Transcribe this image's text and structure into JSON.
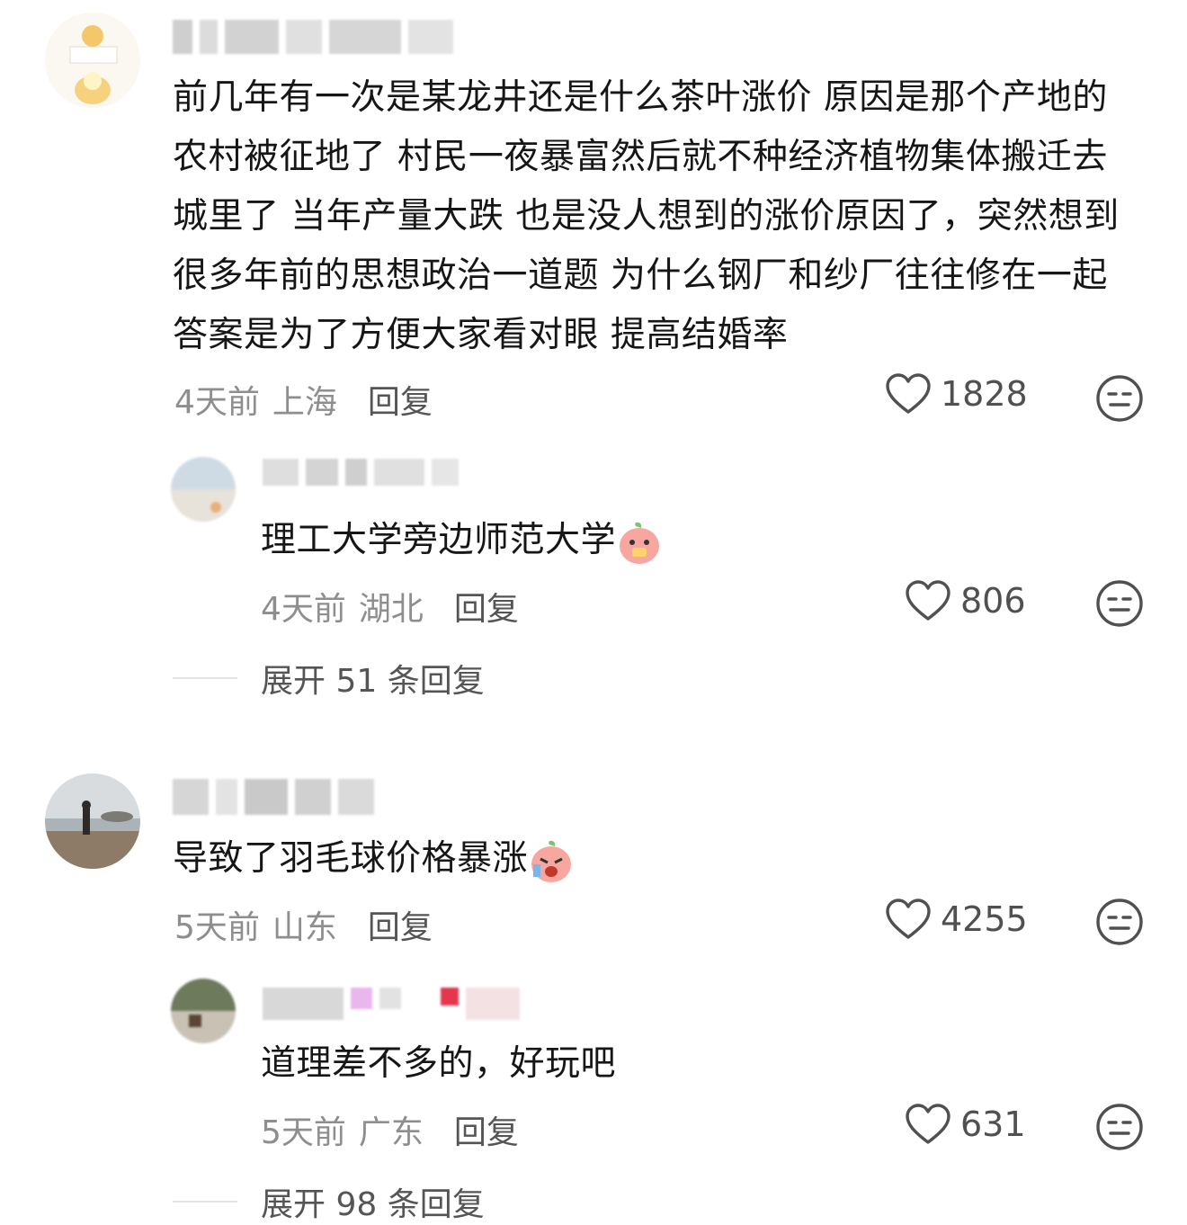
{
  "comments": [
    {
      "text": "前几年有一次是某龙井还是什么茶叶涨价 原因是那个产地的农村被征地了 村民一夜暴富然后就不种经济植物集体搬迁去城里了 当年产量大跌 也是没人想到的涨价原因了，突然想到很多年前的思想政治一道题 为什么钢厂和纱厂往往修在一起 答案是为了方便大家看对眼 提高结婚率",
      "time": "4天前",
      "location": "上海",
      "reply_label": "回复",
      "likes": "1828",
      "reply": {
        "text": "理工大学旁边师范大学",
        "time": "4天前",
        "location": "湖北",
        "reply_label": "回复",
        "likes": "806"
      },
      "expand_label": "展开 51 条回复"
    },
    {
      "text": "导致了羽毛球价格暴涨",
      "time": "5天前",
      "location": "山东",
      "reply_label": "回复",
      "likes": "4255",
      "reply": {
        "text": "道理差不多的，好玩吧",
        "time": "5天前",
        "location": "广东",
        "reply_label": "回复",
        "likes": "631"
      },
      "expand_label": "展开 98 条回复"
    }
  ],
  "icons": {
    "like": "heart-outline-icon",
    "dislike": "neutral-face-icon"
  }
}
